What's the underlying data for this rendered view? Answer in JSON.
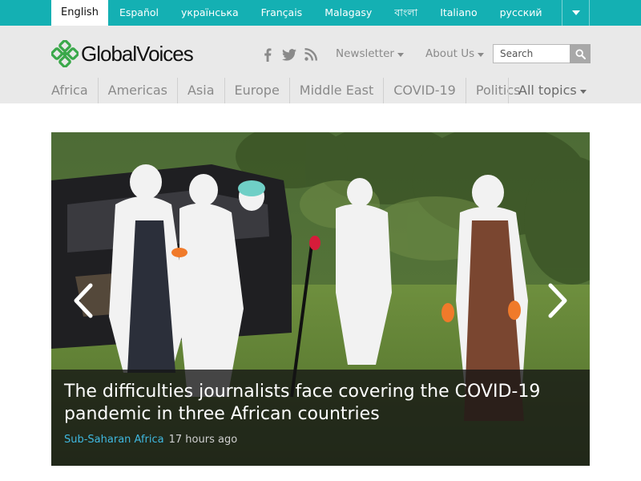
{
  "languages": {
    "items": [
      "English",
      "Español",
      "українська",
      "Français",
      "Malagasy",
      "বাংলা",
      "Italiano",
      "русский"
    ],
    "active_index": 0
  },
  "header": {
    "logo_text_a": "Global",
    "logo_text_b": "Voices",
    "social_icons": [
      "facebook-icon",
      "twitter-icon",
      "rss-icon"
    ],
    "newsletter_label": "Newsletter",
    "about_label": "About Us",
    "search_placeholder": "Search"
  },
  "topics": {
    "items": [
      "Africa",
      "Americas",
      "Asia",
      "Europe",
      "Middle East",
      "COVID-19",
      "Politics"
    ],
    "all_label": "All topics"
  },
  "hero": {
    "headline": "The difficulties journalists face covering the COVID-19 pandemic in three African countries",
    "category": "Sub-Saharan Africa",
    "time": "17 hours ago"
  },
  "colors": {
    "brand_teal": "#14b0b3",
    "logo_green": "#3aa84a",
    "link_blue": "#3fb8df"
  }
}
